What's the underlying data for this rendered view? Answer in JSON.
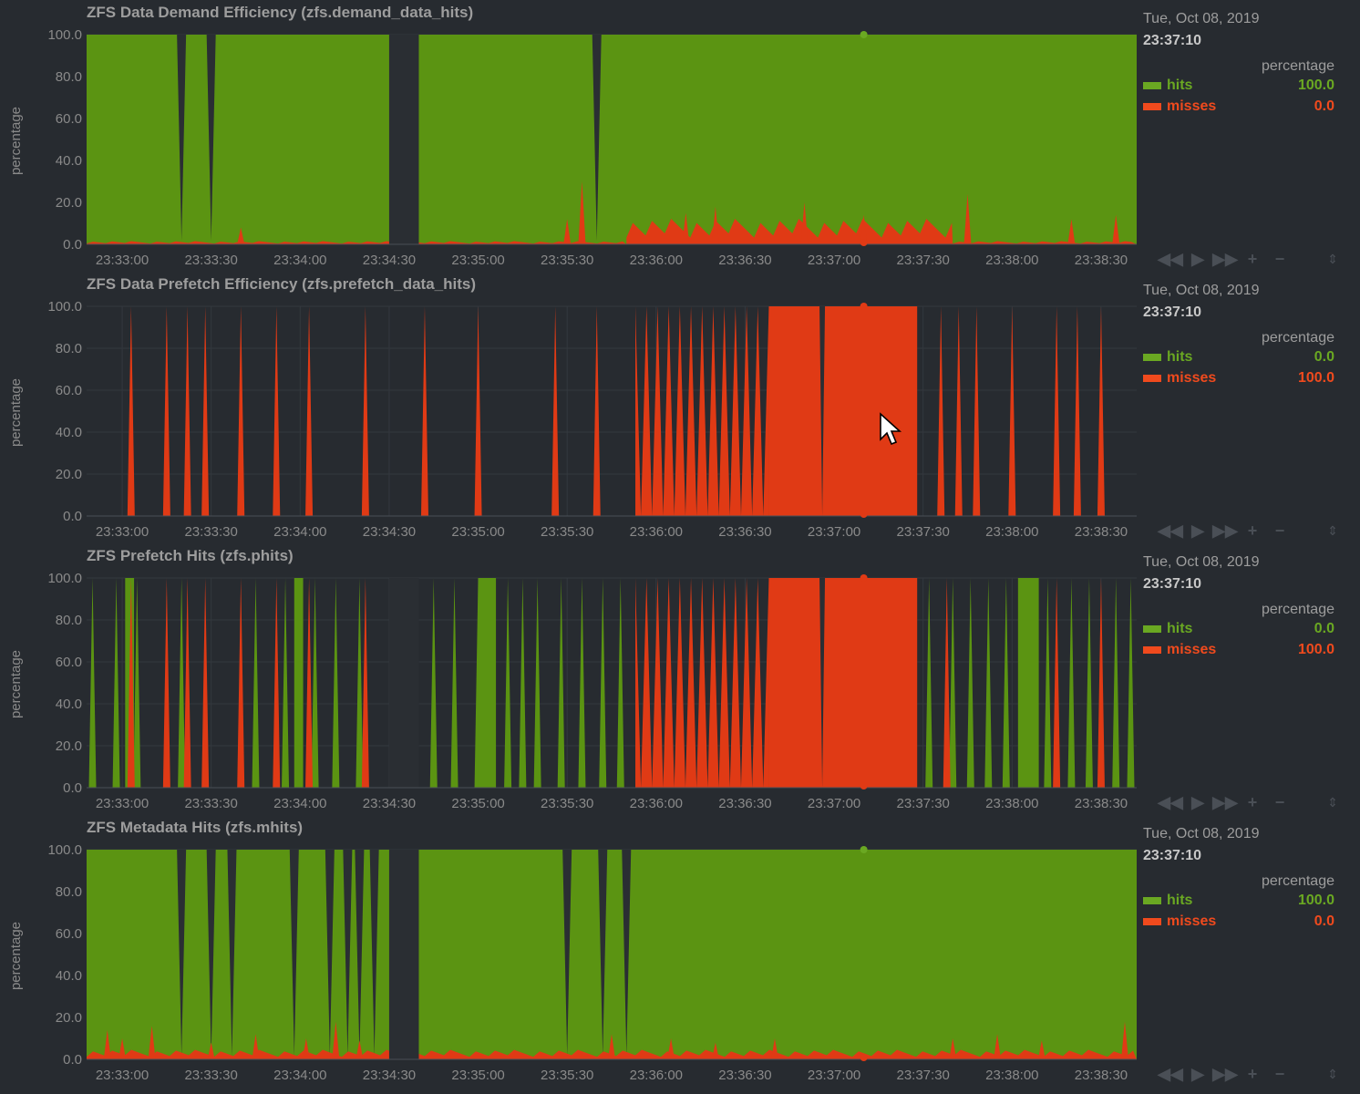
{
  "common": {
    "units": "percentage",
    "ylabel": "percentage",
    "legend_date": "Tue, Oct 08, 2019",
    "legend_time": "23:37:10",
    "y_ticks": [
      "100.0",
      "80.0",
      "60.0",
      "40.0",
      "20.0",
      "0.0"
    ],
    "x_ticks": [
      "23:33:00",
      "23:33:30",
      "23:34:00",
      "23:34:30",
      "23:35:00",
      "23:35:30",
      "23:36:00",
      "23:36:30",
      "23:37:00",
      "23:37:30",
      "23:38:00",
      "23:38:30"
    ],
    "colors": {
      "hits": "#5b9412",
      "misses": "#e03a15",
      "background": "#272b30",
      "grid": "#33383e",
      "gap": "#2a2e33"
    },
    "toolbox_icons": [
      "rewind-icon",
      "play-icon",
      "fast-forward-icon",
      "zoom-in-icon",
      "zoom-out-icon"
    ],
    "toolbox_glyphs": {
      "rewind-icon": "◀◀",
      "play-icon": "▶",
      "fast-forward-icon": "▶▶",
      "zoom-in-icon": "+",
      "zoom-out-icon": "−",
      "resize-icon": "⇕"
    }
  },
  "charts": [
    {
      "id": "demand",
      "title": "ZFS Data Demand Efficiency (zfs.demand_data_hits)",
      "legend": [
        {
          "name": "hits",
          "value": "100.0"
        },
        {
          "name": "misses",
          "value": "0.0"
        }
      ]
    },
    {
      "id": "prefetch",
      "title": "ZFS Data Prefetch Efficiency (zfs.prefetch_data_hits)",
      "legend": [
        {
          "name": "hits",
          "value": "0.0"
        },
        {
          "name": "misses",
          "value": "100.0"
        }
      ]
    },
    {
      "id": "phits",
      "title": "ZFS Prefetch Hits (zfs.phits)",
      "legend": [
        {
          "name": "hits",
          "value": "0.0"
        },
        {
          "name": "misses",
          "value": "100.0"
        }
      ]
    },
    {
      "id": "mhits",
      "title": "ZFS Metadata Hits (zfs.mhits)",
      "legend": [
        {
          "name": "hits",
          "value": "100.0"
        },
        {
          "name": "misses",
          "value": "0.0"
        }
      ]
    }
  ],
  "chart_data": [
    {
      "type": "area",
      "stacked": true,
      "x_range": [
        "23:32:48",
        "23:38:42"
      ],
      "ylim": [
        0,
        100
      ],
      "ylabel": "percentage",
      "grid": true,
      "series": [
        {
          "name": "misses",
          "color": "#e03a15"
        },
        {
          "name": "hits",
          "color": "#5b9412"
        }
      ],
      "gap": [
        "23:34:30",
        "23:34:40"
      ],
      "base_misses": [
        {
          "from": "23:32:48",
          "to": "23:35:50",
          "value": 1
        },
        {
          "from": "23:35:50",
          "to": "23:37:40",
          "value": 8
        },
        {
          "from": "23:37:40",
          "to": "23:38:42",
          "value": 1
        }
      ],
      "miss_spikes": [
        {
          "t": "23:33:40",
          "v": 8
        },
        {
          "t": "23:35:35",
          "v": 30
        },
        {
          "t": "23:35:30",
          "v": 12
        },
        {
          "t": "23:36:10",
          "v": 15
        },
        {
          "t": "23:36:20",
          "v": 18
        },
        {
          "t": "23:36:50",
          "v": 20
        },
        {
          "t": "23:37:10",
          "v": 14
        },
        {
          "t": "23:37:45",
          "v": 24
        },
        {
          "t": "23:38:20",
          "v": 12
        },
        {
          "t": "23:38:35",
          "v": 14
        }
      ],
      "hit_drops": [
        "23:33:20",
        "23:33:30",
        "23:35:40"
      ],
      "dense_miss": null
    },
    {
      "type": "area",
      "stacked": true,
      "x_range": [
        "23:32:48",
        "23:38:42"
      ],
      "ylim": [
        0,
        100
      ],
      "ylabel": "percentage",
      "grid": true,
      "series": [
        {
          "name": "misses",
          "color": "#e03a15"
        },
        {
          "name": "hits",
          "color": "#5b9412"
        }
      ],
      "gap": null,
      "base_misses": [],
      "miss_spikes": [
        {
          "t": "23:33:03",
          "v": 100
        },
        {
          "t": "23:33:15",
          "v": 100
        },
        {
          "t": "23:33:22",
          "v": 100
        },
        {
          "t": "23:33:28",
          "v": 100
        },
        {
          "t": "23:33:40",
          "v": 100
        },
        {
          "t": "23:33:52",
          "v": 100
        },
        {
          "t": "23:34:03",
          "v": 100
        },
        {
          "t": "23:34:22",
          "v": 100
        },
        {
          "t": "23:34:42",
          "v": 100
        },
        {
          "t": "23:35:00",
          "v": 100
        },
        {
          "t": "23:35:26",
          "v": 100
        },
        {
          "t": "23:35:40",
          "v": 100
        },
        {
          "t": "23:37:36",
          "v": 100
        },
        {
          "t": "23:37:42",
          "v": 100
        },
        {
          "t": "23:37:48",
          "v": 100
        },
        {
          "t": "23:38:00",
          "v": 100
        },
        {
          "t": "23:38:15",
          "v": 100
        },
        {
          "t": "23:38:22",
          "v": 100
        },
        {
          "t": "23:38:30",
          "v": 100
        }
      ],
      "hit_drops": [],
      "dense_miss": {
        "from": "23:35:53",
        "to": "23:37:30",
        "solid_from": "23:36:38",
        "solid_to": "23:37:28"
      }
    },
    {
      "type": "area",
      "stacked": true,
      "x_range": [
        "23:32:48",
        "23:38:42"
      ],
      "ylim": [
        0,
        100
      ],
      "ylabel": "percentage",
      "grid": true,
      "series": [
        {
          "name": "misses",
          "color": "#e03a15"
        },
        {
          "name": "hits",
          "color": "#5b9412"
        }
      ],
      "gap": [
        "23:34:30",
        "23:34:40"
      ],
      "base_misses": [],
      "miss_spikes": [
        {
          "t": "23:33:03",
          "v": 100
        },
        {
          "t": "23:33:15",
          "v": 100
        },
        {
          "t": "23:33:22",
          "v": 100
        },
        {
          "t": "23:33:28",
          "v": 100
        },
        {
          "t": "23:33:40",
          "v": 100
        },
        {
          "t": "23:33:52",
          "v": 100
        },
        {
          "t": "23:34:03",
          "v": 100
        },
        {
          "t": "23:34:22",
          "v": 100
        },
        {
          "t": "23:37:38",
          "v": 100
        },
        {
          "t": "23:38:15",
          "v": 100
        },
        {
          "t": "23:38:30",
          "v": 100
        }
      ],
      "hit_spikes": [
        "23:32:50",
        "23:32:58",
        "23:33:05",
        "23:33:20",
        "23:33:45",
        "23:33:55",
        "23:34:05",
        "23:34:12",
        "23:34:20",
        "23:34:38",
        "23:34:45",
        "23:34:52",
        "23:35:00",
        "23:35:10",
        "23:35:15",
        "23:35:20",
        "23:35:28",
        "23:35:35",
        "23:35:42",
        "23:35:48",
        "23:37:32",
        "23:37:40",
        "23:37:46",
        "23:37:52",
        "23:37:58",
        "23:38:05",
        "23:38:12",
        "23:38:20",
        "23:38:26",
        "23:38:35",
        "23:38:40"
      ],
      "hit_blocks": [
        {
          "from": "23:33:01",
          "to": "23:33:04"
        },
        {
          "from": "23:33:58",
          "to": "23:34:01"
        },
        {
          "from": "23:35:00",
          "to": "23:35:06"
        },
        {
          "from": "23:38:02",
          "to": "23:38:09"
        }
      ],
      "dense_miss": {
        "from": "23:35:53",
        "to": "23:37:30",
        "solid_from": "23:36:38",
        "solid_to": "23:37:28"
      }
    },
    {
      "type": "area",
      "stacked": true,
      "x_range": [
        "23:32:48",
        "23:38:42"
      ],
      "ylim": [
        0,
        100
      ],
      "ylabel": "percentage",
      "grid": true,
      "series": [
        {
          "name": "misses",
          "color": "#e03a15"
        },
        {
          "name": "hits",
          "color": "#5b9412"
        }
      ],
      "gap": [
        "23:34:30",
        "23:34:40"
      ],
      "base_misses": [
        {
          "from": "23:32:48",
          "to": "23:38:42",
          "value": 3
        }
      ],
      "miss_spikes": [
        {
          "t": "23:32:55",
          "v": 14
        },
        {
          "t": "23:33:00",
          "v": 10
        },
        {
          "t": "23:33:10",
          "v": 16
        },
        {
          "t": "23:33:30",
          "v": 8
        },
        {
          "t": "23:33:45",
          "v": 12
        },
        {
          "t": "23:34:02",
          "v": 10
        },
        {
          "t": "23:34:12",
          "v": 18
        },
        {
          "t": "23:34:20",
          "v": 9
        },
        {
          "t": "23:35:45",
          "v": 12
        },
        {
          "t": "23:36:05",
          "v": 10
        },
        {
          "t": "23:36:20",
          "v": 8
        },
        {
          "t": "23:36:40",
          "v": 10
        },
        {
          "t": "23:37:40",
          "v": 10
        },
        {
          "t": "23:37:55",
          "v": 12
        },
        {
          "t": "23:38:10",
          "v": 9
        },
        {
          "t": "23:38:38",
          "v": 18
        }
      ],
      "hit_drops": [
        "23:33:20",
        "23:33:30",
        "23:33:37",
        "23:33:58",
        "23:34:10",
        "23:34:16",
        "23:34:20",
        "23:34:25",
        "23:35:30",
        "23:35:42",
        "23:35:50"
      ],
      "dense_miss": null
    }
  ]
}
